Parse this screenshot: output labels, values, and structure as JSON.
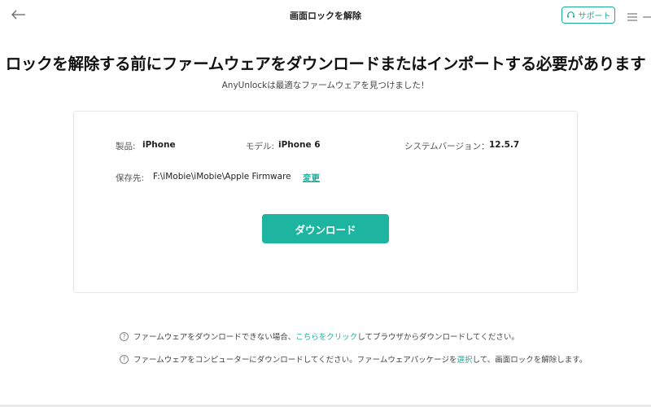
{
  "window": {
    "title": "画面ロックを解除",
    "support_label": "サポート"
  },
  "header": {
    "headline": "ロックを解除する前にファームウェアをダウンロードまたはインポートする必要があります",
    "subheadline": "AnyUnlockは最適なファームウェアを見つけました！"
  },
  "device_info": {
    "product_label": "製品:",
    "product_value": "iPhone",
    "model_label": "モデル:",
    "model_value": "iPhone 6",
    "system_version_label": "システムバージョン：",
    "system_version_value": "12.5.7",
    "save_path_label": "保存先:",
    "save_path_value": "F:\\iMobie\\iMobie\\Apple Firmware",
    "change_label": "変更"
  },
  "download_button_label": "ダウンロード",
  "notes": [
    {
      "before": "ファームウェアをダウンロードできない場合、",
      "link": "こちらをクリック",
      "after": "してブラウザからダウンロードしてください。"
    },
    {
      "before": "ファームウェアをコンピューターにダウンロードしてください。ファームウェアパッケージを",
      "link": "選択",
      "after": "して、画面ロックを解除します。"
    }
  ],
  "colors": {
    "accent": "#1db4a0",
    "link": "#1bae9b"
  },
  "icons": {
    "back": "arrow-left-icon",
    "support": "headset-icon",
    "menu": "hamburger-icon",
    "minimize": "minimize-icon",
    "help": "question-circle-icon"
  }
}
